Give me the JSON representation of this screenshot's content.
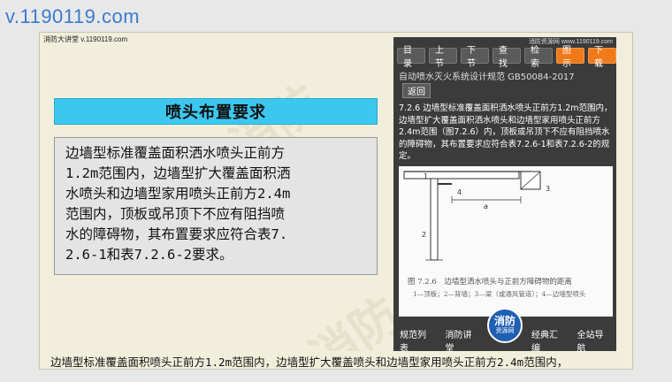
{
  "page": {
    "top_url": "v.1190119.com"
  },
  "slide": {
    "watermark": "消防大讲堂 v.1190119.com",
    "title": "喷头布置要求",
    "body_lines": [
      "边墙型标准覆盖面积洒水喷头正前方",
      "1.2m范围内，边墙型扩大覆盖面积洒",
      "水喷头和边墙型家用喷头正前方2.4m",
      "范围内，顶板或吊顶下不应有阻挡喷",
      "水的障碍物，其布置要求应符合表7.",
      "2.6-1和表7.2.6-2要求。"
    ],
    "caption": "边墙型标准覆盖面积喷头正前方1.2m范围内，边墙型扩大覆盖喷头和边墙型家用喷头正前方2.4m范围内，"
  },
  "phone": {
    "header_url": "消防资源网 www.1190119.com",
    "buttons": [
      "目录",
      "上节",
      "下节",
      "查找",
      "检索",
      "图示",
      "下载"
    ],
    "doc_title": "自动喷水灭火系统设计规范 GB50084-2017",
    "back_label": "返回",
    "paragraph": "7.2.6 边墙型标准覆盖面积洒水喷头正前方1.2m范围内，边墙型扩大覆盖面积洒水喷头和边墙型家用喷头正前方2.4m范围（图7.2.6）内，顶板或吊顶下不应有阻挡喷水的障碍物，其布置要求应符合表7.2.6-1和表7.2.6-2的规定。",
    "figure_caption": "图 7.2.6　边墙型洒水喷头与正前方障碍物的距离",
    "figure_legend": "1—顶板；2—背墙；3—梁（或通风管道）；4—边墙型喷头",
    "figure_labels": {
      "n1": "1",
      "n2": "2",
      "n3": "3",
      "n4": "4",
      "a": "a"
    },
    "nav_items": [
      "规范列表",
      "消防讲堂",
      "经典汇编",
      "全站导航"
    ],
    "logo": {
      "line1": "消防",
      "line2": "资源网"
    }
  }
}
